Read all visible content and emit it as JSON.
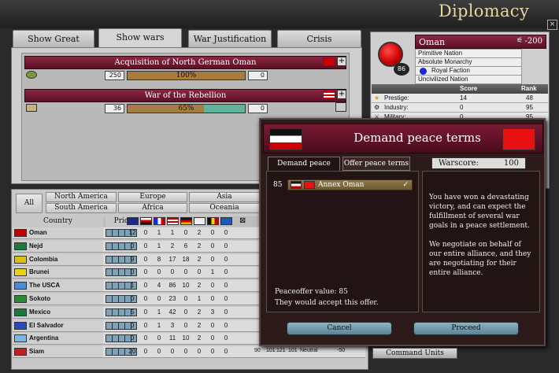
{
  "window": {
    "title": "Diplomacy",
    "close_label": "×"
  },
  "tabs": [
    {
      "label": "Show Great Powers",
      "active": false
    },
    {
      "label": "Show wars",
      "active": true
    },
    {
      "label": "War Justification",
      "active": false
    },
    {
      "label": "Crisis",
      "active": false
    }
  ],
  "wars": [
    {
      "title": "Acquisition of North German Oman",
      "left_value": "250",
      "progress_label": "100%",
      "progress": 1.0,
      "right_value": "0"
    },
    {
      "title": "War of the Rebellion",
      "left_value": "36",
      "progress_label": "65%",
      "progress": 0.65,
      "right_value": "0"
    }
  ],
  "nation": {
    "name": "Oman",
    "score": "-200",
    "globe_number": "86",
    "lines": [
      "Primitive Nation",
      "Absolute Monarchy",
      "Royal Faction",
      "Uncivilized Nation"
    ],
    "stats_headers": {
      "score": "Score",
      "rank": "Rank"
    },
    "stats": [
      {
        "label": "Prestige:",
        "score": "14",
        "rank": "48"
      },
      {
        "label": "Industry:",
        "score": "0",
        "rank": "95"
      },
      {
        "label": "Military:",
        "score": "0",
        "rank": "95"
      }
    ]
  },
  "regions": {
    "all": "All",
    "items": [
      "North America",
      "Europe",
      "Asia",
      "South America",
      "Africa",
      "Oceania"
    ]
  },
  "list": {
    "col_country": "Country",
    "col_prio": "Prio",
    "rows": [
      {
        "name": "Oman",
        "flag": "#c00000",
        "vals": [
          "12",
          "0",
          "1",
          "1",
          "0",
          "2",
          "0",
          "0"
        ]
      },
      {
        "name": "Nejd",
        "flag": "#1a7a3a",
        "vals": [
          "0",
          "0",
          "1",
          "2",
          "6",
          "2",
          "0",
          "0"
        ]
      },
      {
        "name": "Colombia",
        "flag": "#d8c21a",
        "vals": [
          "9",
          "0",
          "8",
          "17",
          "18",
          "2",
          "0",
          "0"
        ]
      },
      {
        "name": "Brunei",
        "flag": "#e8d21a",
        "vals": [
          "0",
          "0",
          "0",
          "0",
          "0",
          "0",
          "1",
          "0"
        ]
      },
      {
        "name": "The USCA",
        "flag": "#4a8ad8",
        "vals": [
          "1",
          "0",
          "4",
          "86",
          "10",
          "2",
          "0",
          "0"
        ]
      },
      {
        "name": "Sokoto",
        "flag": "#2a8a3a",
        "vals": [
          "0",
          "0",
          "0",
          "23",
          "0",
          "1",
          "0",
          "0"
        ]
      },
      {
        "name": "Mexico",
        "flag": "#1a7a3a",
        "vals": [
          "5",
          "0",
          "1",
          "42",
          "0",
          "2",
          "3",
          "0"
        ]
      },
      {
        "name": "El Salvador",
        "flag": "#2a4ab8",
        "vals": [
          "0",
          "0",
          "1",
          "3",
          "0",
          "2",
          "0",
          "0"
        ]
      },
      {
        "name": "Argentina",
        "flag": "#7ab8e8",
        "vals": [
          "0",
          "0",
          "0",
          "11",
          "10",
          "2",
          "0",
          "0"
        ]
      },
      {
        "name": "Siam",
        "flag": "#c02020",
        "vals": [
          "20",
          "0",
          "0",
          "0",
          "0",
          "0",
          "0",
          "0"
        ]
      }
    ],
    "siam_tail": [
      "90",
      "101",
      "121",
      "101",
      "Neutral",
      "-50"
    ]
  },
  "dialog": {
    "title": "Demand peace terms",
    "tabs": [
      "Demand peace terms",
      "Offer peace terms"
    ],
    "warscore_label": "Warscore:",
    "warscore_value": "100",
    "term": {
      "cost": "85",
      "label": "Annex Oman",
      "check": "✓"
    },
    "peaceoffer": "Peaceoffer value: 85",
    "accept": "They would accept this offer.",
    "desc1": "You have won a devastating victory, and can expect the fulfillment of several war goals in a peace settlement.",
    "desc2": "We negotiate on behalf of our entire alliance, and they are negotiating for their entire alliance.",
    "cancel": "Cancel",
    "proceed": "Proceed"
  },
  "command_units": "Command Units",
  "colors": {
    "war_bar": "#a77d3f",
    "war_bar_green": "#5fb39a",
    "dialog_header": "#7a1b34",
    "button": "#8fb3c2"
  }
}
